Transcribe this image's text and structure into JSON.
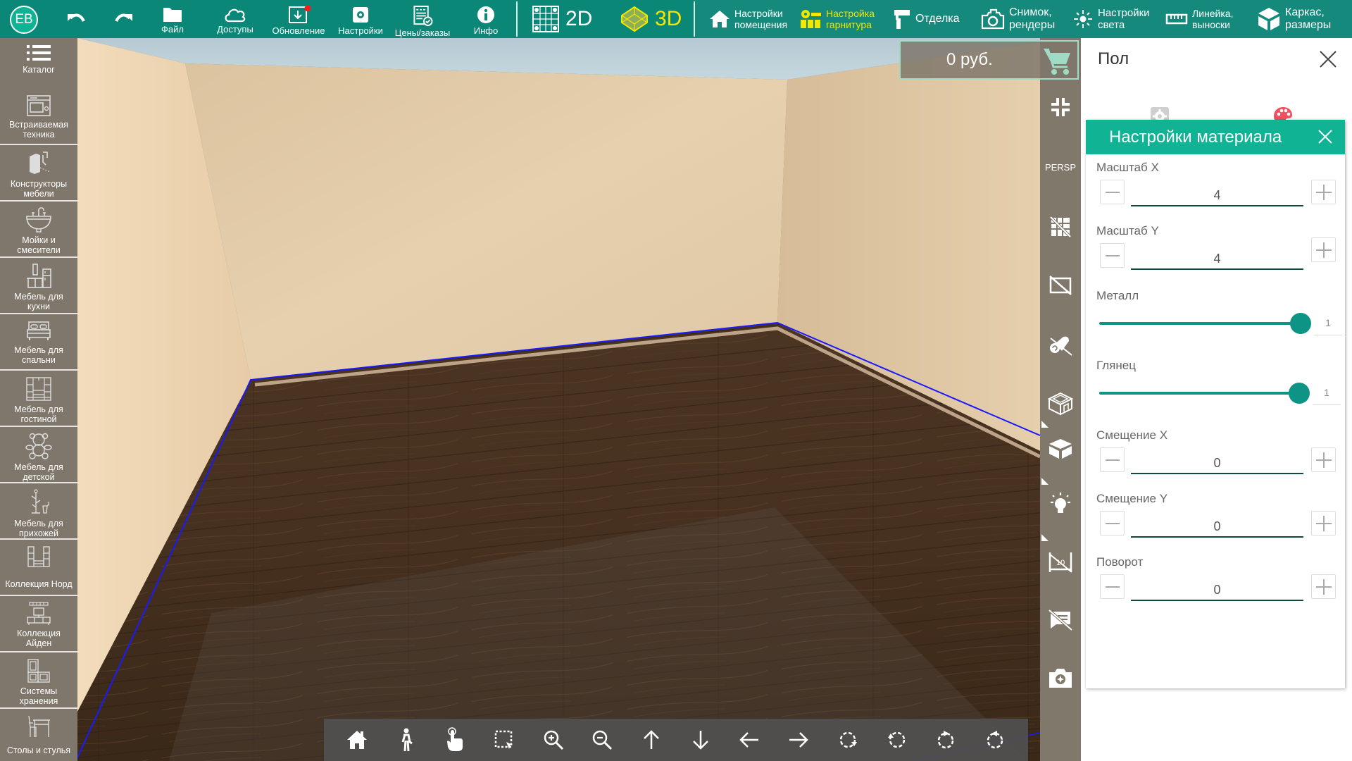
{
  "topbar": {
    "avatar_initials": "EB",
    "file_label": "Файл",
    "access_label": "Доступы",
    "update_label": "Обновление",
    "settings_label": "Настройки",
    "prices_label": "Цены/заказы",
    "info_label": "Инфо",
    "mode_2d_label": "2D",
    "mode_3d_label": "3D",
    "active_mode": "3D",
    "room_settings_label": "Настройки\nпомещения",
    "room_settings_line1": "Настройки",
    "room_settings_line2": "помещения",
    "headset_line1": "Настройка",
    "headset_line2": "гарнитура",
    "finish_label": "Отделка",
    "snapshot_line1": "Снимок,",
    "snapshot_line2": "рендеры",
    "light_line1": "Настройки",
    "light_line2": "света",
    "ruler_line1": "Линейка,",
    "ruler_line2": "выноски",
    "frame_line1": "Каркас,",
    "frame_line2": "размеры",
    "update_badge": true
  },
  "sidebar": {
    "items": [
      {
        "label": "Каталог",
        "icon": "list-icon"
      },
      {
        "label": "Встраиваемая техника",
        "icon": "oven-icon"
      },
      {
        "label": "Конструкторы мебели",
        "icon": "furniture-constructor-icon"
      },
      {
        "label": "Мойки и смесители",
        "icon": "sink-icon"
      },
      {
        "label": "Мебель для кухни",
        "icon": "kitchen-icon"
      },
      {
        "label": "Мебель для спальни",
        "icon": "bed-icon"
      },
      {
        "label": "Мебель для гостиной",
        "icon": "living-room-icon"
      },
      {
        "label": "Мебель для детской",
        "icon": "teddy-bear-icon"
      },
      {
        "label": "Мебель для прихожей",
        "icon": "coat-rack-icon"
      },
      {
        "label": "Коллекция Норд",
        "icon": "wall-unit-icon"
      },
      {
        "label": "Коллекция Айден",
        "icon": "tv-stand-icon"
      },
      {
        "label": "Системы хранения",
        "icon": "storage-icon"
      },
      {
        "label": "Столы и стулья",
        "icon": "table-chair-icon"
      }
    ]
  },
  "viewport": {
    "cart_price": "0 руб.",
    "persp_label": "PERSP",
    "right_tools": [
      "collapse-icon",
      "persp",
      "grid-off-icon",
      "wall-off-icon",
      "wallpaper-off-icon",
      "room-box-icon",
      "cube-icon",
      "light-bulb-icon",
      "dimensions-off-icon",
      "comments-off-icon",
      "camera-icon"
    ],
    "bottom_tools": [
      "home-icon",
      "walk-icon",
      "hand-pointer-icon",
      "select-area-icon",
      "zoom-in-icon",
      "zoom-out-icon",
      "arrow-up-icon",
      "arrow-down-icon",
      "arrow-left-icon",
      "arrow-right-icon",
      "orbit-cw-icon",
      "orbit-ccw-icon",
      "rotate-left-icon",
      "rotate-right-icon"
    ]
  },
  "panel": {
    "title": "Пол",
    "active_tab": "material",
    "material": {
      "header": "Настройки материала",
      "scale_x_label": "Масштаб X",
      "scale_x_value": "4",
      "scale_y_label": "Масштаб Y",
      "scale_y_value": "4",
      "metal_label": "Металл",
      "metal_value": "1",
      "metal_fraction": 1.0,
      "gloss_label": "Глянец",
      "gloss_value": "1",
      "gloss_fraction": 1.0,
      "offset_x_label": "Смещение X",
      "offset_x_value": "0",
      "offset_y_label": "Смещение Y",
      "offset_y_value": "0",
      "rotation_label": "Поворот",
      "rotation_value": "0"
    }
  },
  "colors": {
    "topbar": "#0b8777",
    "accent": "#10b394",
    "slider": "#0e9484",
    "active_mode": "#f3e600",
    "palette_icon": "#f05060",
    "sidebar": "#7f776b",
    "room_outline": "#1a1aff"
  }
}
